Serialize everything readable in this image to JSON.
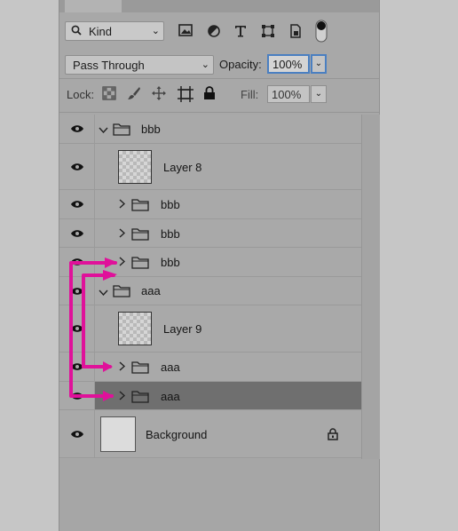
{
  "filter": {
    "kind_label": "Kind",
    "icons": [
      "image-filter-icon",
      "adjustment-filter-icon",
      "type-filter-icon",
      "shape-filter-icon",
      "smart-object-filter-icon",
      "filter-toggle-icon"
    ]
  },
  "blend": {
    "mode": "Pass Through",
    "opacity_label": "Opacity:",
    "opacity_value": "100%"
  },
  "lock": {
    "label": "Lock:",
    "fill_label": "Fill:",
    "fill_value": "100%"
  },
  "layers": [
    {
      "name": "bbb",
      "type": "group",
      "expanded": true,
      "indent": 0,
      "visible": true
    },
    {
      "name": "Layer 8",
      "type": "layer",
      "indent": 1,
      "visible": true
    },
    {
      "name": "bbb",
      "type": "group",
      "expanded": false,
      "indent": 1,
      "visible": true
    },
    {
      "name": "bbb",
      "type": "group",
      "expanded": false,
      "indent": 1,
      "visible": true
    },
    {
      "name": "bbb",
      "type": "group",
      "expanded": false,
      "indent": 1,
      "visible": true
    },
    {
      "name": "aaa",
      "type": "group",
      "expanded": true,
      "indent": 0,
      "visible": true
    },
    {
      "name": "Layer 9",
      "type": "layer",
      "indent": 1,
      "visible": true
    },
    {
      "name": "aaa",
      "type": "group",
      "expanded": false,
      "indent": 1,
      "visible": true
    },
    {
      "name": "aaa",
      "type": "group",
      "expanded": false,
      "indent": 1,
      "visible": true,
      "selected": true
    },
    {
      "name": "Background",
      "type": "background",
      "indent": 0,
      "visible": true,
      "locked": true
    }
  ],
  "colors": {
    "annotation": "#e0119a",
    "focus": "#4a7fc1",
    "selected_row": "#6f6f6f"
  }
}
